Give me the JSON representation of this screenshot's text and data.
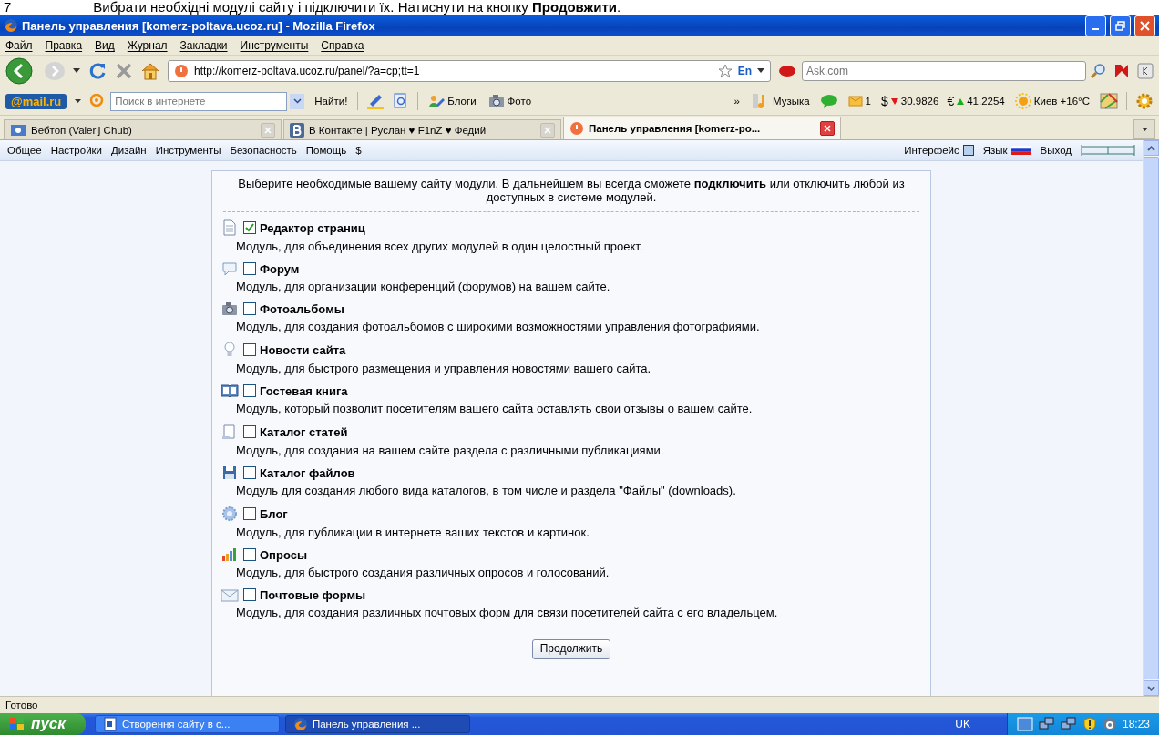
{
  "doc_caption": {
    "number": "7",
    "text": "Вибрати необхідні модулі сайту і підключити їх. Натиснути на кнопку **Продовжити**."
  },
  "window": {
    "title": "Панель управления [komerz-poltava.ucoz.ru] - Mozilla Firefox"
  },
  "menu": [
    "Файл",
    "Правка",
    "Вид",
    "Журнал",
    "Закладки",
    "Инструменты",
    "Справка"
  ],
  "nav": {
    "url": "http://komerz-poltava.ucoz.ru/panel/?a=cp;tt=1",
    "language": "En",
    "search_placeholder": "Ask.com"
  },
  "mail_toolbar": {
    "logo": "@mail.ru",
    "search_placeholder": "Поиск в интернете",
    "find_button": "Найти!",
    "blogs": "Блоги",
    "photo": "Фото",
    "more": "»",
    "music": "Музыка",
    "mail_count": "1",
    "dollar_sign": "$",
    "dollar_rate": "30.9826",
    "euro_sign": "€",
    "euro_rate": "41.2254",
    "weather": "Киев +16°C"
  },
  "tabs": [
    {
      "label": "Вебтоп (Valerij Chub)",
      "selected": false
    },
    {
      "label": "В Контакте | Руслан ♥ F1nZ ♥ Федий",
      "selected": false
    },
    {
      "label": "Панель управления [komerz-po...",
      "selected": true
    }
  ],
  "panel_menu": [
    "Общее",
    "Настройки",
    "Дизайн",
    "Инструменты",
    "Безопасность",
    "Помощь",
    "$"
  ],
  "panel_right": {
    "interface": "Интерфейс",
    "language": "Язык",
    "logout": "Выход"
  },
  "intro": "Выберите необходимые вашему сайту модули. В дальнейшем вы всегда сможете **подключить** или отключить любой из доступных в системе модулей.",
  "modules": [
    {
      "name": "Редактор страниц",
      "description": "Модуль, для объединения всех других модулей в один целостный проект.",
      "checked": true
    },
    {
      "name": "Форум",
      "description": "Модуль, для организации конференций (форумов) на вашем сайте.",
      "checked": false
    },
    {
      "name": "Фотоальбомы",
      "description": "Модуль, для создания фотоальбомов с широкими возможностями управления фотографиями.",
      "checked": false
    },
    {
      "name": "Новости сайта",
      "description": "Модуль, для быстрого размещения и управления новостями вашего сайта.",
      "checked": false
    },
    {
      "name": "Гостевая книга",
      "description": "Модуль, который позволит посетителям вашего сайта оставлять свои отзывы о вашем сайте.",
      "checked": false
    },
    {
      "name": "Каталог статей",
      "description": "Модуль, для создания на вашем сайте раздела с различными публикациями.",
      "checked": false
    },
    {
      "name": "Каталог файлов",
      "description": "Модуль для создания любого вида каталогов, в том числе и раздела \"Файлы\" (downloads).",
      "checked": false
    },
    {
      "name": "Блог",
      "description": "Модуль, для публикации в интернете ваших текстов и картинок.",
      "checked": false
    },
    {
      "name": "Опросы",
      "description": "Модуль, для быстрого создания различных опросов и голосований.",
      "checked": false
    },
    {
      "name": "Почтовые формы",
      "description": "Модуль, для создания различных почтовых форм для связи посетителей сайта с его владельцем.",
      "checked": false
    }
  ],
  "continue_button": "Продолжить",
  "status_bar": "Готово",
  "taskbar": {
    "start": "пуск",
    "tasks": [
      {
        "label": "Створення сайту в с...",
        "selected": false
      },
      {
        "label": "Панель управления ...",
        "selected": true
      }
    ],
    "language": "UK",
    "clock": "18:23"
  }
}
